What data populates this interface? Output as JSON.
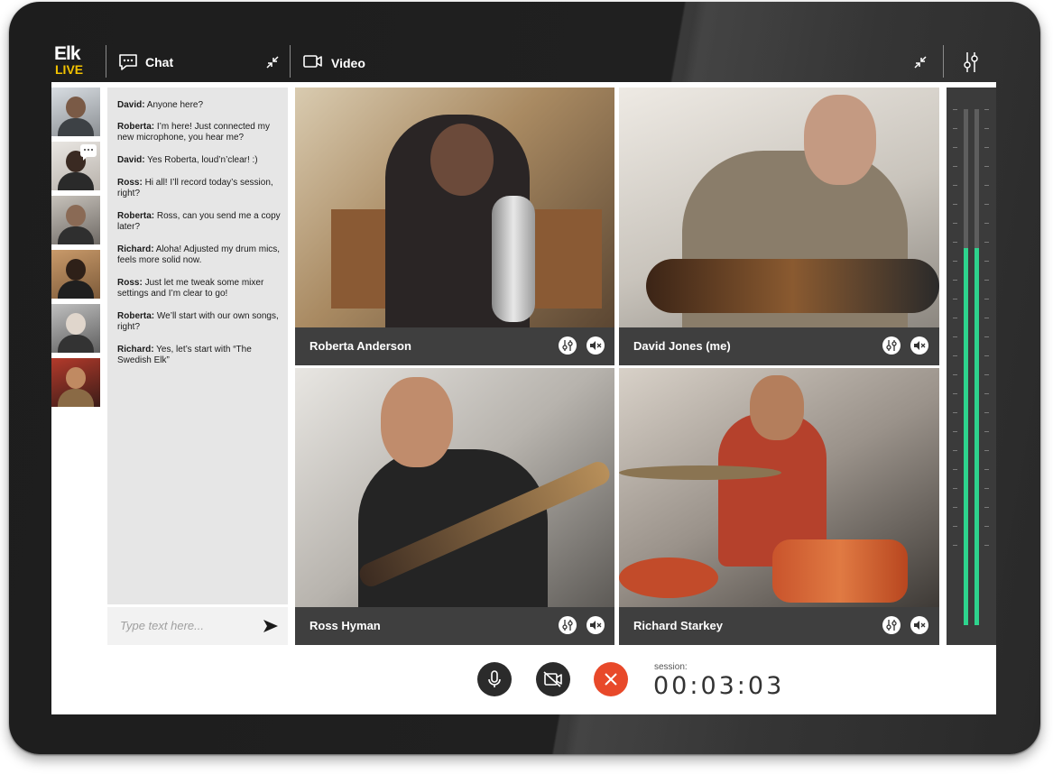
{
  "app": {
    "logo_line1": "Elk",
    "logo_line2": "LIVE"
  },
  "header": {
    "chat_label": "Chat",
    "video_label": "Video"
  },
  "icons": {
    "chat": "chat-bubble-icon",
    "collapse": "collapse-arrows-icon",
    "video": "video-camera-icon",
    "mixer": "mixer-sliders-icon",
    "send": "send-arrow-icon",
    "mute": "speaker-mute-icon",
    "mic": "microphone-icon",
    "camera_off": "camera-off-icon",
    "end_call": "close-icon"
  },
  "chat": {
    "messages": [
      {
        "author": "David:",
        "text": " Anyone here?"
      },
      {
        "author": "Roberta:",
        "text": " I’m here! Just connected my new microphone, you hear me?"
      },
      {
        "author": "David:",
        "text": " Yes Roberta, loud’n’clear! :)"
      },
      {
        "author": "Ross:",
        "text": " Hi all! I’ll record today’s session, right?"
      },
      {
        "author": "Roberta:",
        "text": " Ross, can you send me a copy later?"
      },
      {
        "author": "Richard:",
        "text": " Aloha! Adjusted my drum mics, feels more solid now."
      },
      {
        "author": "Ross:",
        "text": " Just let me tweak some mixer settings and I’m clear to go!"
      },
      {
        "author": "Roberta:",
        "text": " We’ll start with our own songs, right?"
      },
      {
        "author": "Richard:",
        "text": " Yes, let’s start with “The Swedish Elk”"
      }
    ],
    "input_placeholder": "Type text here..."
  },
  "participants": [
    {
      "name": "Roberta Anderson"
    },
    {
      "name": "David Jones (me)"
    },
    {
      "name": "Ross Hyman"
    },
    {
      "name": "Richard Starkey"
    }
  ],
  "meter": {
    "level_left": 0.73,
    "level_right": 0.73
  },
  "session": {
    "label": "session:",
    "time": "00:03:03"
  },
  "colors": {
    "accent_green": "#2ed38d",
    "end_call_red": "#e8492a",
    "logo_yellow": "#f2c200",
    "frame_dark": "#1f1f1f"
  }
}
